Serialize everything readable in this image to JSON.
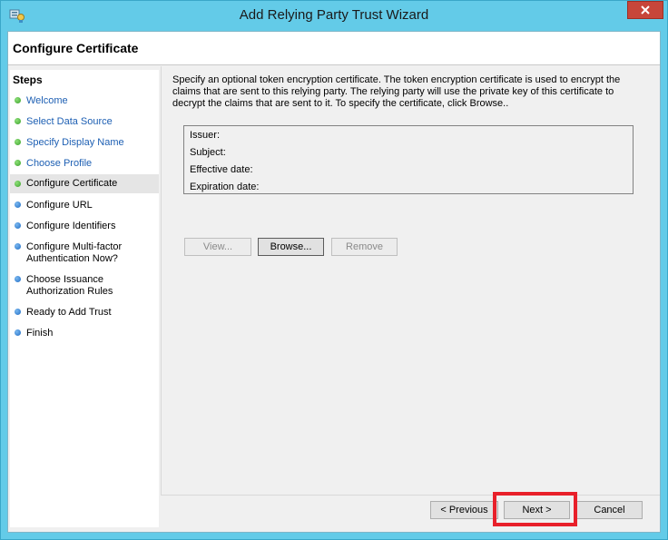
{
  "window": {
    "title": "Add Relying Party Trust Wizard"
  },
  "header": {
    "title": "Configure Certificate"
  },
  "steps": {
    "heading": "Steps",
    "items": [
      {
        "label": "Welcome",
        "status": "done"
      },
      {
        "label": "Select Data Source",
        "status": "done"
      },
      {
        "label": "Specify Display Name",
        "status": "done"
      },
      {
        "label": "Choose Profile",
        "status": "done"
      },
      {
        "label": "Configure Certificate",
        "status": "current"
      },
      {
        "label": "Configure URL",
        "status": "pending"
      },
      {
        "label": "Configure Identifiers",
        "status": "pending"
      },
      {
        "label": "Configure Multi-factor Authentication Now?",
        "status": "pending"
      },
      {
        "label": "Choose Issuance Authorization Rules",
        "status": "pending"
      },
      {
        "label": "Ready to Add Trust",
        "status": "pending"
      },
      {
        "label": "Finish",
        "status": "pending"
      }
    ]
  },
  "main": {
    "description": "Specify an optional token encryption certificate.  The token encryption certificate is used to encrypt the claims that are sent to this relying party.  The relying party will use the private key of this certificate to decrypt the claims that are sent to it.  To specify the certificate, click Browse..",
    "certificate": {
      "issuer_label": "Issuer:",
      "subject_label": "Subject:",
      "effective_label": "Effective date:",
      "expiration_label": "Expiration date:"
    },
    "buttons": {
      "view": "View...",
      "browse": "Browse...",
      "remove": "Remove"
    }
  },
  "footer": {
    "previous": "< Previous",
    "next": "Next >",
    "cancel": "Cancel"
  },
  "colors": {
    "window_frame": "#63cbe8",
    "link": "#1d5fb3",
    "done_dot": "#3aa12a",
    "pending_dot": "#1f6cc4",
    "highlight": "#e8202a"
  }
}
